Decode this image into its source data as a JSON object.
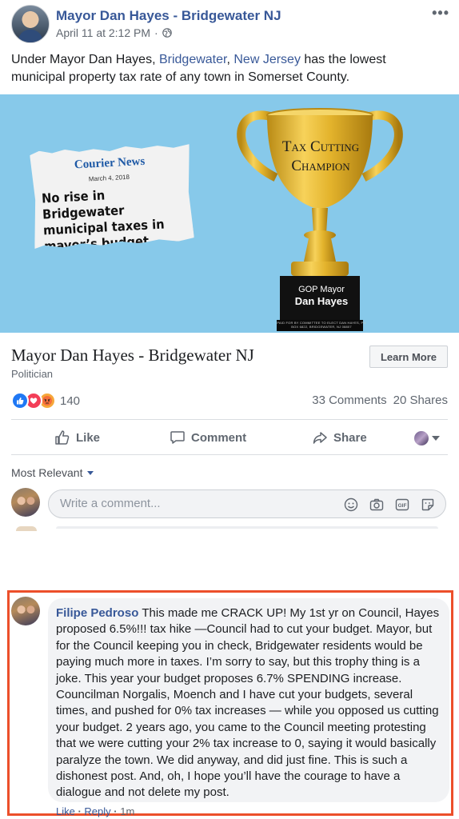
{
  "post": {
    "page_name": "Mayor Dan Hayes - Bridgewater NJ",
    "timestamp": "April 11 at 2:12 PM",
    "separator": "·",
    "more_icon": "more-horizontal-icon",
    "text_before": "Under Mayor Dan Hayes, ",
    "link_bridgewater": "Bridgewater",
    "text_comma": ", ",
    "link_nj": "New Jersey",
    "text_after": " has the lowest municipal property tax rate of any town in Somerset County."
  },
  "image": {
    "clipping_paper": "Courier News",
    "clipping_date": "March 4, 2018",
    "clipping_headline": "No rise in Bridgewater municipal taxes in mayor’s budget",
    "trophy_title_1": "Tax Cutting",
    "trophy_title_2": "Champion",
    "plaque_line_1": "GOP Mayor",
    "plaque_line_2": "Dan Hayes",
    "plaque_fine_print": "PAID FOR BY COMMITTEE TO ELECT DAN HAYES, PO BOX 6822, BRIDGEWATER, NJ 08807"
  },
  "link_box": {
    "title": "Mayor Dan Hayes - Bridgewater NJ",
    "subtitle": "Politician",
    "button": "Learn More"
  },
  "stats": {
    "reaction_count": "140",
    "comments": "33 Comments",
    "shares": "20 Shares",
    "reactions": [
      "like",
      "love",
      "angry"
    ]
  },
  "actions": {
    "like": "Like",
    "comment": "Comment",
    "share": "Share"
  },
  "comments_section": {
    "sort_label": "Most Relevant",
    "input_placeholder": "Write a comment...",
    "input_icons": [
      "emoji-icon",
      "camera-icon",
      "gif-icon",
      "sticker-icon"
    ]
  },
  "highlighted_comment": {
    "author": "Filipe Pedroso",
    "text": "This made me CRACK UP! My 1st yr on Council, Hayes proposed 6.5%!!! tax hike —Council had to cut your budget. Mayor, but for the Council keeping you in check, Bridgewater residents would be paying much more in taxes. I’m sorry to say, but this trophy thing is a joke. This year your budget proposes 6.7% SPENDING increase. Councilman Norgalis, Moench and I have cut your budgets, several times, and pushed for 0% tax increases — while you opposed us cutting your budget. 2 years ago, you came to the Council meeting protesting that we were cutting your 2% tax increase to 0, saying it would basically paralyze the town. We did anyway, and did just fine. This is such a dishonest post. And, oh, I hope you’ll have the courage to have a dialogue and not delete my post.",
    "like": "Like",
    "reply": "Reply",
    "age": "1m",
    "separator": " · "
  },
  "colors": {
    "link_blue": "#385898",
    "highlight_border": "#ec4f2a",
    "banner_bg": "#87c9ea",
    "trophy_gold": "#e3b32c"
  }
}
